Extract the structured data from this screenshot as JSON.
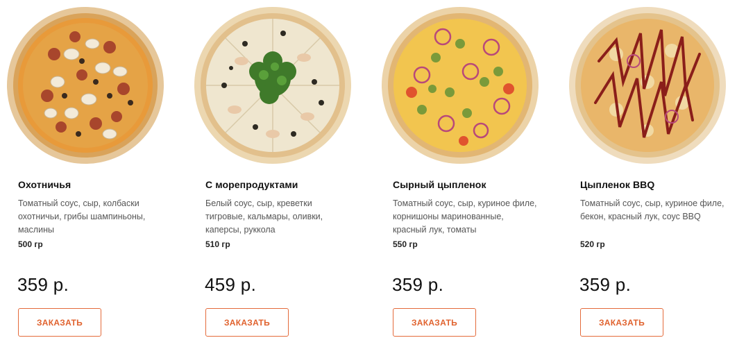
{
  "products": [
    {
      "name": "Охотничья",
      "description": "Томатный соус, сыр, колбаски охотничьи, грибы шампиньоны, маслины",
      "weight": "500 гр",
      "price": "359 р.",
      "order_label": "ЗАКАЗАТЬ",
      "image": "pizza-hunter-image"
    },
    {
      "name": "С морепродуктами",
      "description": "Белый соус, сыр, креветки тигровые, кальмары, оливки, каперсы, руккола",
      "weight": "510 гр",
      "price": "459 р.",
      "order_label": "ЗАКАЗАТЬ",
      "image": "pizza-seafood-image"
    },
    {
      "name": "Сырный цыпленок",
      "description": "Томатный соус, сыр, куриное филе, корнишоны маринованные, красный лук, томаты",
      "weight": "550 гр",
      "price": "359 р.",
      "order_label": "ЗАКАЗАТЬ",
      "image": "pizza-cheese-chicken-image"
    },
    {
      "name": "Цыпленок BBQ",
      "description": "Томатный соус, сыр, куриное филе, бекон, красный лук, соус BBQ",
      "weight": "520 гр",
      "price": "359 р.",
      "order_label": "ЗАКАЗАТЬ",
      "image": "pizza-bbq-chicken-image"
    }
  ],
  "colors": {
    "accent": "#e0622e",
    "button_border": "#e46a3a",
    "text": "#111111",
    "muted_text": "#555555"
  }
}
